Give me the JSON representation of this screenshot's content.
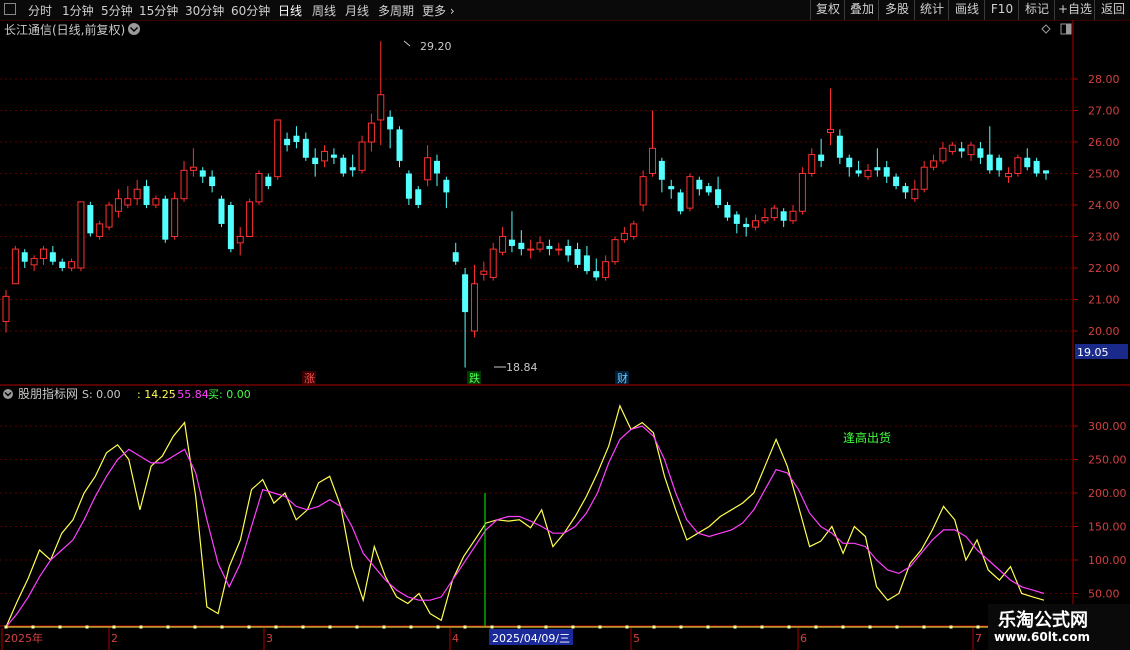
{
  "toolbar": {
    "periods": [
      "分时",
      "1分钟",
      "5分钟",
      "15分钟",
      "30分钟",
      "60分钟",
      "日线",
      "周线",
      "月线",
      "多周期",
      "更多"
    ],
    "active_period": "日线",
    "right_buttons": [
      "复权",
      "叠加",
      "多股",
      "统计",
      "画线",
      "F10",
      "标记",
      "+自选",
      "返回"
    ]
  },
  "stock": {
    "title": "长江通信(日线,前复权)"
  },
  "indicator": {
    "name": "股朋指标网",
    "readout_s": "S: 0.00",
    "readout_v1": ": 14.25",
    "readout_v2": ": 55.84",
    "readout_buy": "买: 0.00",
    "annotation": "逢高出货"
  },
  "colors": {
    "up": "#ff3030",
    "down": "#54ffff",
    "grid": "#5a0000",
    "axis": "#b00000",
    "yellow": "#ffff50",
    "magenta": "#ff40ff",
    "green": "#40ff40",
    "signal_line": "#00ff00"
  },
  "events": [
    "涨",
    "跌",
    "财"
  ],
  "current_price_tag": "19.05",
  "date_axis": {
    "labels": [
      "2025年",
      "2",
      "3",
      "4",
      "5",
      "6",
      "7"
    ],
    "highlight": "2025/04/09/三"
  },
  "watermark": {
    "line1": "乐淘公式网",
    "line2": "www.60lt.com"
  },
  "chart_data": [
    {
      "type": "candlestick",
      "title": "长江通信(日线,前复权)",
      "y_ticks": [
        20.0,
        21.0,
        22.0,
        23.0,
        24.0,
        25.0,
        26.0,
        27.0,
        28.0
      ],
      "ylim": [
        19.05,
        30.2
      ],
      "max_label": "29.20",
      "min_label": "18.84",
      "grid": true,
      "candles": [
        [
          20.3,
          21.1,
          19.95,
          21.3
        ],
        [
          21.5,
          22.6,
          21.5,
          22.7
        ],
        [
          22.5,
          22.2,
          22.0,
          22.6
        ],
        [
          22.1,
          22.3,
          21.9,
          22.4
        ],
        [
          22.3,
          22.6,
          22.1,
          22.7
        ],
        [
          22.5,
          22.2,
          22.1,
          22.7
        ],
        [
          22.2,
          22.0,
          21.9,
          22.3
        ],
        [
          22.0,
          22.2,
          21.9,
          22.3
        ],
        [
          22.0,
          24.1,
          21.9,
          24.1
        ],
        [
          24.0,
          23.1,
          23.0,
          24.1
        ],
        [
          23.0,
          23.4,
          22.9,
          23.5
        ],
        [
          23.3,
          24.0,
          23.2,
          24.1
        ],
        [
          23.8,
          24.2,
          23.6,
          24.5
        ],
        [
          24.0,
          24.2,
          23.9,
          24.6
        ],
        [
          24.2,
          24.5,
          24.0,
          24.8
        ],
        [
          24.6,
          24.0,
          23.9,
          24.8
        ],
        [
          24.0,
          24.2,
          23.9,
          24.3
        ],
        [
          24.2,
          22.9,
          22.8,
          24.3
        ],
        [
          23.0,
          24.2,
          22.9,
          24.4
        ],
        [
          24.2,
          25.1,
          24.1,
          25.4
        ],
        [
          25.1,
          25.2,
          24.9,
          25.8
        ],
        [
          25.1,
          24.9,
          24.7,
          25.2
        ],
        [
          24.9,
          24.6,
          24.4,
          25.1
        ],
        [
          24.2,
          23.4,
          23.3,
          24.3
        ],
        [
          24.0,
          22.6,
          22.5,
          24.1
        ],
        [
          22.8,
          23.0,
          22.4,
          23.3
        ],
        [
          23.0,
          24.1,
          23.0,
          24.2
        ],
        [
          24.1,
          25.0,
          24.0,
          25.1
        ],
        [
          24.9,
          24.6,
          24.5,
          25.0
        ],
        [
          24.9,
          26.7,
          24.8,
          26.7
        ],
        [
          26.1,
          25.9,
          25.7,
          26.3
        ],
        [
          26.2,
          26.0,
          25.8,
          26.5
        ],
        [
          26.1,
          25.5,
          25.4,
          26.3
        ],
        [
          25.5,
          25.3,
          24.9,
          25.8
        ],
        [
          25.4,
          25.7,
          25.2,
          25.9
        ],
        [
          25.6,
          25.5,
          25.3,
          25.8
        ],
        [
          25.5,
          25.0,
          24.9,
          25.6
        ],
        [
          25.2,
          25.1,
          24.9,
          25.6
        ],
        [
          25.1,
          26.0,
          25.0,
          26.2
        ],
        [
          26.0,
          26.6,
          25.7,
          26.9
        ],
        [
          26.7,
          27.5,
          25.9,
          29.2
        ],
        [
          26.8,
          26.4,
          25.8,
          27.0
        ],
        [
          26.4,
          25.4,
          25.2,
          26.5
        ],
        [
          25.0,
          24.2,
          24.0,
          25.1
        ],
        [
          24.5,
          24.0,
          23.9,
          24.6
        ],
        [
          24.8,
          25.5,
          24.6,
          25.9
        ],
        [
          25.4,
          25.0,
          24.6,
          25.6
        ],
        [
          24.8,
          24.4,
          23.9,
          24.9
        ],
        [
          22.5,
          22.2,
          22.1,
          22.8
        ],
        [
          21.8,
          20.6,
          18.84,
          22.0
        ],
        [
          20.0,
          21.5,
          19.8,
          22.1
        ],
        [
          21.8,
          21.9,
          21.6,
          22.2
        ],
        [
          21.7,
          22.6,
          21.6,
          22.8
        ],
        [
          22.5,
          23.0,
          22.4,
          23.3
        ],
        [
          22.9,
          22.7,
          22.5,
          23.8
        ],
        [
          22.8,
          22.6,
          22.4,
          23.2
        ],
        [
          22.6,
          22.6,
          22.3,
          22.9
        ],
        [
          22.6,
          22.8,
          22.5,
          23.0
        ],
        [
          22.7,
          22.6,
          22.4,
          22.9
        ],
        [
          22.6,
          22.6,
          22.4,
          22.8
        ],
        [
          22.7,
          22.4,
          22.2,
          22.9
        ],
        [
          22.6,
          22.1,
          22.0,
          22.8
        ],
        [
          22.4,
          21.9,
          21.8,
          22.7
        ],
        [
          21.9,
          21.7,
          21.6,
          22.3
        ],
        [
          21.7,
          22.2,
          21.6,
          22.4
        ],
        [
          22.2,
          22.9,
          22.1,
          23.0
        ],
        [
          22.9,
          23.1,
          22.8,
          23.3
        ],
        [
          23.0,
          23.4,
          22.9,
          23.5
        ],
        [
          24.0,
          24.9,
          23.8,
          25.1
        ],
        [
          25.0,
          25.8,
          24.9,
          27.0
        ],
        [
          25.4,
          24.8,
          24.4,
          25.5
        ],
        [
          24.6,
          24.5,
          24.2,
          24.8
        ],
        [
          24.4,
          23.8,
          23.7,
          24.5
        ],
        [
          23.9,
          24.9,
          23.8,
          25.0
        ],
        [
          24.8,
          24.5,
          24.3,
          24.9
        ],
        [
          24.6,
          24.4,
          24.3,
          24.7
        ],
        [
          24.5,
          24.0,
          23.9,
          24.9
        ],
        [
          24.0,
          23.6,
          23.5,
          24.1
        ],
        [
          23.7,
          23.4,
          23.1,
          23.8
        ],
        [
          23.4,
          23.3,
          23.0,
          23.6
        ],
        [
          23.3,
          23.5,
          23.2,
          23.7
        ],
        [
          23.5,
          23.6,
          23.4,
          23.9
        ],
        [
          23.6,
          23.9,
          23.5,
          24.0
        ],
        [
          23.8,
          23.5,
          23.3,
          23.9
        ],
        [
          23.5,
          23.8,
          23.4,
          24.0
        ],
        [
          23.8,
          25.0,
          23.7,
          25.2
        ],
        [
          25.0,
          25.6,
          24.9,
          25.8
        ],
        [
          25.6,
          25.4,
          25.2,
          26.1
        ],
        [
          26.3,
          26.4,
          25.9,
          27.7
        ],
        [
          26.2,
          25.5,
          25.3,
          26.4
        ],
        [
          25.5,
          25.2,
          24.9,
          25.6
        ],
        [
          25.1,
          25.0,
          24.9,
          25.4
        ],
        [
          24.9,
          25.1,
          24.8,
          25.3
        ],
        [
          25.2,
          25.1,
          24.9,
          25.8
        ],
        [
          25.2,
          24.9,
          24.7,
          25.4
        ],
        [
          24.9,
          24.6,
          24.5,
          25.0
        ],
        [
          24.6,
          24.4,
          24.2,
          24.7
        ],
        [
          24.2,
          24.5,
          24.1,
          24.8
        ],
        [
          24.5,
          25.2,
          24.4,
          25.4
        ],
        [
          25.2,
          25.4,
          25.1,
          25.6
        ],
        [
          25.4,
          25.8,
          25.3,
          26.0
        ],
        [
          25.7,
          25.9,
          25.6,
          26.0
        ],
        [
          25.8,
          25.7,
          25.5,
          26.0
        ],
        [
          25.6,
          25.9,
          25.4,
          26.0
        ],
        [
          25.8,
          25.5,
          25.3,
          26.0
        ],
        [
          25.6,
          25.1,
          25.0,
          26.5
        ],
        [
          25.5,
          25.1,
          24.9,
          25.6
        ],
        [
          24.9,
          25.0,
          24.7,
          25.2
        ],
        [
          25.0,
          25.5,
          24.9,
          25.6
        ],
        [
          25.5,
          25.2,
          25.1,
          25.8
        ],
        [
          25.4,
          25.0,
          24.9,
          25.5
        ],
        [
          25.1,
          25.0,
          24.8,
          25.1
        ]
      ]
    },
    {
      "type": "line",
      "title": "股朋指标网",
      "y_ticks": [
        50,
        100,
        150,
        200,
        250,
        300
      ],
      "ylim": [
        0,
        340
      ],
      "grid": true,
      "series": [
        {
          "name": "S",
          "values": [
            0,
            38,
            73,
            115,
            100,
            140,
            160,
            200,
            225,
            260,
            272,
            250,
            175,
            240,
            255,
            285,
            305,
            195,
            30,
            20,
            90,
            130,
            205,
            220,
            185,
            200,
            160,
            175,
            215,
            225,
            180,
            90,
            40,
            120,
            75,
            45,
            35,
            50,
            20,
            10,
            70,
            105,
            130,
            155,
            160,
            158,
            160,
            148,
            175,
            120,
            140,
            165,
            195,
            230,
            270,
            330,
            295,
            305,
            290,
            225,
            175,
            130,
            140,
            150,
            165,
            175,
            185,
            200,
            240,
            280,
            240,
            180,
            120,
            128,
            150,
            110,
            150,
            135,
            60,
            40,
            50,
            95,
            115,
            145,
            180,
            160,
            100,
            130,
            85,
            70,
            90,
            50,
            45,
            40
          ]
        },
        {
          "name": "",
          "values": [
            0,
            20,
            45,
            75,
            100,
            115,
            130,
            160,
            195,
            225,
            250,
            265,
            255,
            245,
            245,
            255,
            265,
            230,
            160,
            95,
            60,
            95,
            150,
            205,
            200,
            195,
            180,
            175,
            180,
            190,
            180,
            150,
            110,
            90,
            70,
            55,
            45,
            40,
            40,
            45,
            70,
            95,
            120,
            145,
            160,
            165,
            165,
            158,
            150,
            140,
            140,
            150,
            170,
            200,
            245,
            280,
            295,
            300,
            285,
            250,
            200,
            160,
            140,
            135,
            140,
            145,
            155,
            175,
            205,
            235,
            230,
            205,
            170,
            150,
            140,
            125,
            125,
            120,
            100,
            85,
            80,
            90,
            110,
            130,
            145,
            145,
            135,
            115,
            100,
            85,
            70,
            60,
            55,
            50
          ]
        }
      ],
      "markers": [
        {
          "value": 0,
          "label": "买"
        }
      ]
    }
  ]
}
